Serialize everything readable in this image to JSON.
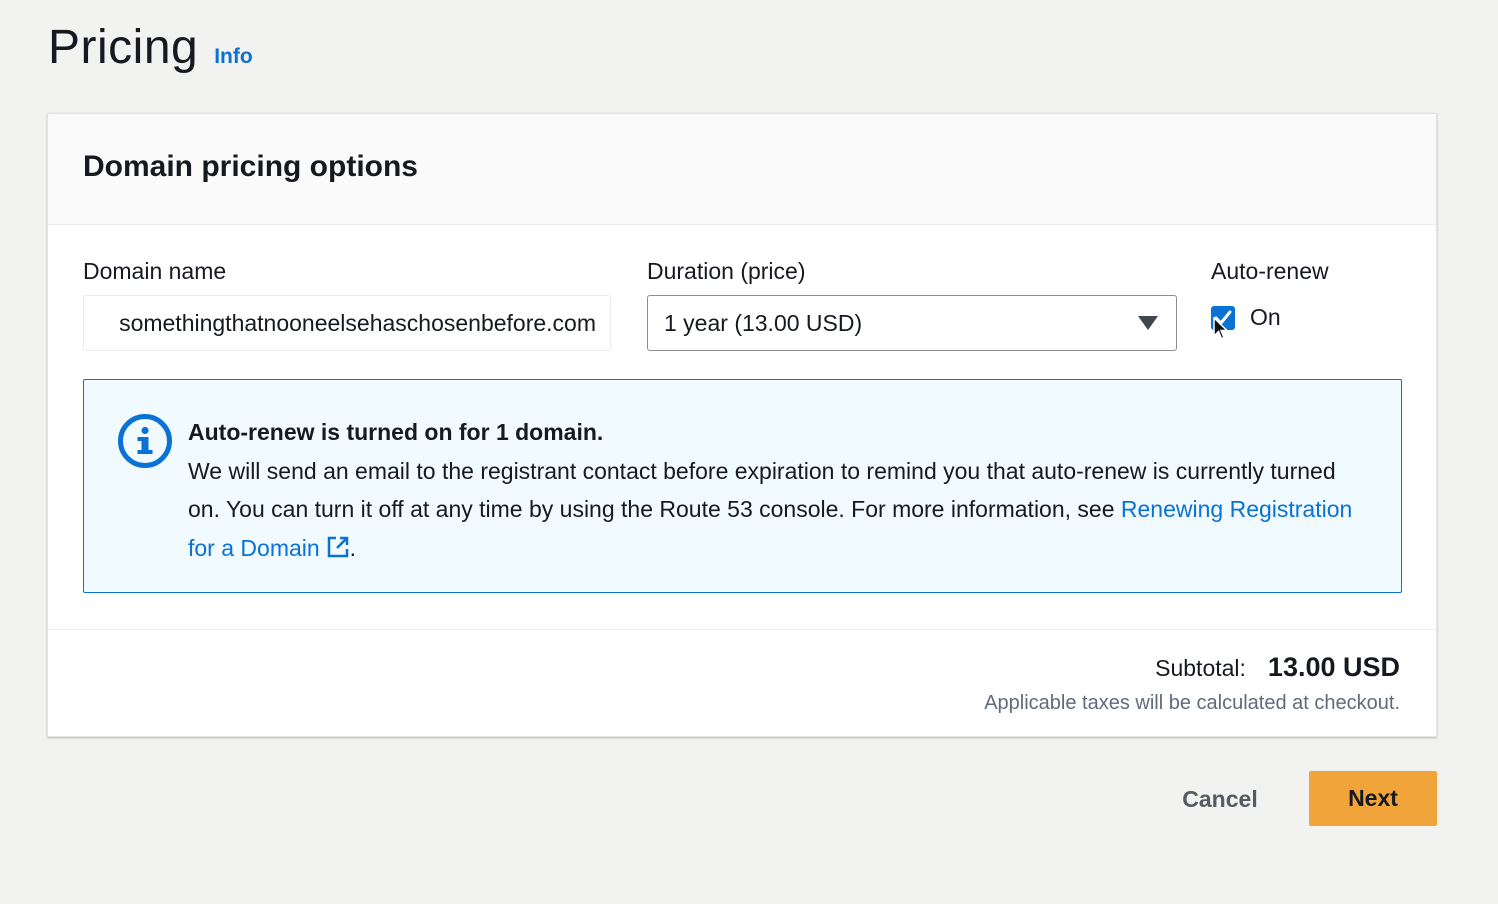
{
  "page": {
    "title": "Pricing",
    "info_link": "Info"
  },
  "card": {
    "title": "Domain pricing options",
    "domain_name": {
      "label": "Domain name",
      "value": "somethingthatnooneelsehaschosenbefore.com"
    },
    "duration": {
      "label": "Duration (price)",
      "selected": "1 year (13.00 USD)"
    },
    "auto_renew": {
      "label": "Auto-renew",
      "checkbox_label": "On",
      "checked": true
    },
    "alert": {
      "title": "Auto-renew is turned on for 1 domain.",
      "body": "We will send an email to the registrant contact before expiration to remind you that auto-renew is currently turned on. You can turn it off at any time by using the Route 53 console. For more information, see",
      "link_text": "Renewing Registration for a Domain",
      "trailing": "."
    },
    "footer": {
      "subtotal_label": "Subtotal:",
      "subtotal_value": "13.00 USD",
      "tax_note": "Applicable taxes will be calculated at checkout."
    }
  },
  "actions": {
    "cancel_label": "Cancel",
    "next_label": "Next"
  },
  "colors": {
    "accent": "#0972d3",
    "primary_button": "#f0a43a",
    "alert_bg": "#f1faff"
  },
  "icons": [
    "info-circle-icon",
    "external-link-icon",
    "checkmark-icon",
    "caret-down-icon",
    "mouse-cursor-icon"
  ]
}
